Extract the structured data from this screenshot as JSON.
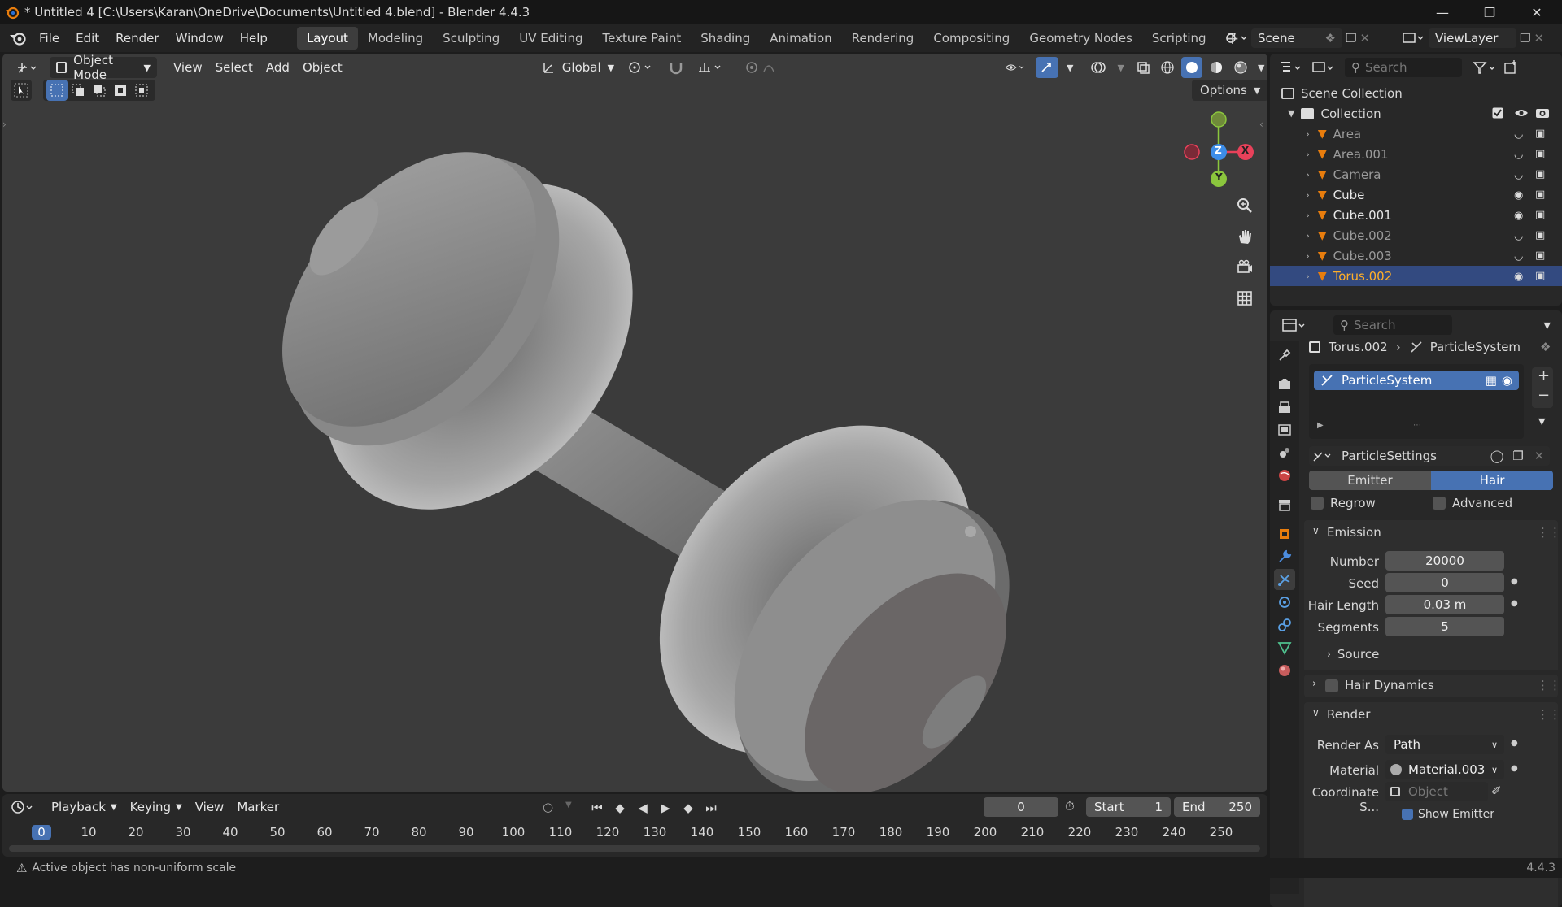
{
  "window": {
    "title": "* Untitled 4 [C:\\Users\\Karan\\OneDrive\\Documents\\Untitled 4.blend] - Blender 4.4.3"
  },
  "menu": {
    "items": [
      "File",
      "Edit",
      "Render",
      "Window",
      "Help"
    ]
  },
  "workspaces": [
    "Layout",
    "Modeling",
    "Sculpting",
    "UV Editing",
    "Texture Paint",
    "Shading",
    "Animation",
    "Rendering",
    "Compositing",
    "Geometry Nodes",
    "Scripting"
  ],
  "active_workspace": "Layout",
  "scene": {
    "name": "Scene",
    "view_layer": "ViewLayer"
  },
  "viewport": {
    "mode": "Object Mode",
    "menus": [
      "View",
      "Select",
      "Add",
      "Object"
    ],
    "orientation": "Global",
    "options_label": "Options",
    "gizmo": {
      "x": "X",
      "y": "Y",
      "z": "Z"
    }
  },
  "outliner": {
    "search_placeholder": "Search",
    "scene_collection": "Scene Collection",
    "collection": "Collection",
    "items": [
      {
        "name": "Area",
        "visible": false
      },
      {
        "name": "Area.001",
        "visible": false
      },
      {
        "name": "Camera",
        "visible": false
      },
      {
        "name": "Cube",
        "visible": true
      },
      {
        "name": "Cube.001",
        "visible": true
      },
      {
        "name": "Cube.002",
        "visible": false
      },
      {
        "name": "Cube.003",
        "visible": false
      },
      {
        "name": "Torus.002",
        "visible": true,
        "selected": true
      }
    ]
  },
  "properties": {
    "search_placeholder": "Search",
    "breadcrumb": {
      "object": "Torus.002",
      "system": "ParticleSystem"
    },
    "list_item": "ParticleSystem",
    "settings_name": "ParticleSettings",
    "type_tabs": {
      "emitter": "Emitter",
      "hair": "Hair",
      "active": "Hair"
    },
    "regrow_label": "Regrow",
    "advanced_label": "Advanced",
    "emission": {
      "header": "Emission",
      "number_label": "Number",
      "number": "20000",
      "seed_label": "Seed",
      "seed": "0",
      "hair_length_label": "Hair Length",
      "hair_length": "0.03 m",
      "segments_label": "Segments",
      "segments": "5",
      "source": "Source"
    },
    "hair_dynamics": "Hair Dynamics",
    "render": {
      "header": "Render",
      "render_as_label": "Render As",
      "render_as": "Path",
      "material_label": "Material",
      "material": "Material.003",
      "coord_label": "Coordinate S...",
      "coord_placeholder": "Object",
      "show_emitter": "Show Emitter"
    }
  },
  "timeline": {
    "menus": [
      "Playback",
      "Keying",
      "View",
      "Marker"
    ],
    "current_frame": "0",
    "start_label": "Start",
    "start": "1",
    "end_label": "End",
    "end": "250",
    "ticks": [
      "0",
      "10",
      "20",
      "30",
      "40",
      "50",
      "60",
      "70",
      "80",
      "90",
      "100",
      "110",
      "120",
      "130",
      "140",
      "150",
      "160",
      "170",
      "180",
      "190",
      "200",
      "210",
      "220",
      "230",
      "240",
      "250"
    ]
  },
  "status": {
    "message": "Active object has non-uniform scale",
    "version": "4.4.3"
  },
  "colors": {
    "accent": "#4772b3",
    "selection": "#334a80",
    "viewport_bg": "#3b3b3b",
    "axis_x": "#e8415a",
    "axis_y": "#8bc63d",
    "axis_z": "#3d8de8"
  }
}
